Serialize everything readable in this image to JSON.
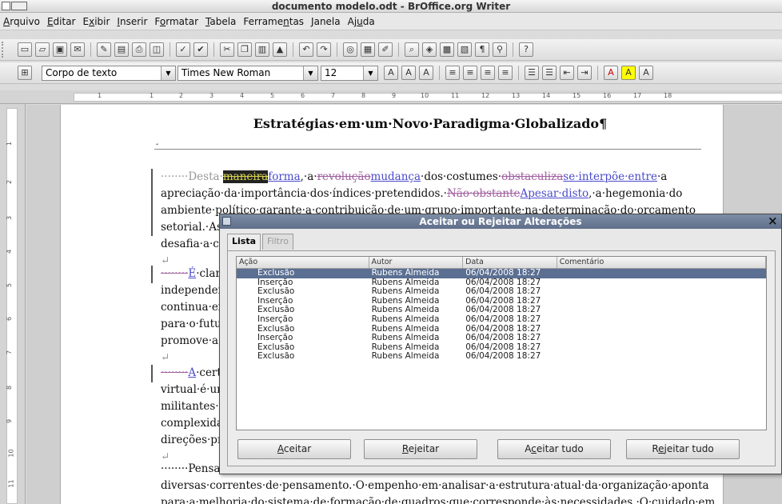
{
  "window": {
    "title": "documento modelo.odt - BrOffice.org Writer"
  },
  "menu": [
    {
      "pre": "",
      "key": "A",
      "post": "rquivo"
    },
    {
      "pre": "",
      "key": "E",
      "post": "ditar"
    },
    {
      "pre": "E",
      "key": "x",
      "post": "ibir"
    },
    {
      "pre": "",
      "key": "I",
      "post": "nserir"
    },
    {
      "pre": "F",
      "key": "o",
      "post": "rmatar"
    },
    {
      "pre": "",
      "key": "T",
      "post": "abela"
    },
    {
      "pre": "Ferrame",
      "key": "n",
      "post": "tas"
    },
    {
      "pre": "",
      "key": "J",
      "post": "anela"
    },
    {
      "pre": "Aj",
      "key": "u",
      "post": "da"
    }
  ],
  "format_bar": {
    "paragraph_style": "Corpo de texto",
    "font_name": "Times New Roman",
    "font_size": "12"
  },
  "ruler": {
    "h_ticks": [
      "1",
      "1",
      "2",
      "3",
      "4",
      "5",
      "6",
      "7",
      "8",
      "9",
      "10",
      "11",
      "12",
      "13",
      "14",
      "15",
      "16",
      "17",
      "18"
    ],
    "v_ticks": [
      "1",
      "2",
      "3",
      "4",
      "5",
      "6",
      "7",
      "8",
      "9",
      "10",
      "11"
    ]
  },
  "document": {
    "heading": "Estratégias·em·um·Novo·Paradigma·Globalizado¶",
    "p1": {
      "l1_a": "········Desta·",
      "l1_hl": "maneira",
      "l1_ins1": "forma",
      "l1_b": ",·a·",
      "l1_del1": "revolução",
      "l1_ins2": "mudança",
      "l1_c": "·dos·costumes·",
      "l1_del2": "obstaculiza",
      "l1_ins3": "se·interpõe·entre",
      "l1_d": "·a",
      "l2_a": "apreciação·da·importância·dos·índices·pretendidos.·",
      "l2_del": "Não·obstante",
      "l2_ins": "Apesar·disto",
      "l2_b": ",·a·hegemonia·do",
      "l3": "ambiente·político·garante·a·contribuição·de·um·grupo·importante·na·determinação·do·orçamento",
      "l4": "setorial.·As·expe",
      "l5": "desafia·a·capacid"
    },
    "p2": {
      "l1_del": "········",
      "l1_ins": "É",
      "l1_a": "·claro·qu",
      "l2": "independenteme",
      "l3": "continua·expansã",
      "l4": "para·o·futuro.·A·",
      "l5": "promove·a·alava"
    },
    "p3": {
      "l1_del": "········",
      "l1_ins": "A",
      "l1_a": "·certifica",
      "l2": "virtual·é·uma·da",
      "l3": "militantes·nos·ob",
      "l4": "complexidade·do",
      "l5": "direções·preferen"
    },
    "p4": {
      "l1": "········Pensando",
      "l2": "diversas·correntes·de·pensamento.·O·empenho·em·analisar·a·estrutura·atual·da·organização·aponta",
      "l3": "para·a·melhoria·do·sistema·de·formação·de·quadros·que·corresponde·às·necessidades.·O·cuidado·em"
    },
    "return_mark": "↵",
    "pilcrow_small": "¸"
  },
  "dialog": {
    "title": "Aceitar ou Rejeitar Alterações",
    "close_glyph": "×",
    "tabs": [
      "Lista",
      "Filtro"
    ],
    "columns": [
      "Ação",
      "Autor",
      "Data",
      "Comentário"
    ],
    "rows": [
      {
        "action": "Exclusão",
        "author": "Rubens Almeida",
        "date": "06/04/2008 18:27",
        "comment": "",
        "selected": true
      },
      {
        "action": "Inserção",
        "author": "Rubens Almeida",
        "date": "06/04/2008 18:27",
        "comment": ""
      },
      {
        "action": "Exclusão",
        "author": "Rubens Almeida",
        "date": "06/04/2008 18:27",
        "comment": ""
      },
      {
        "action": "Inserção",
        "author": "Rubens Almeida",
        "date": "06/04/2008 18:27",
        "comment": ""
      },
      {
        "action": "Exclusão",
        "author": "Rubens Almeida",
        "date": "06/04/2008 18:27",
        "comment": ""
      },
      {
        "action": "Inserção",
        "author": "Rubens Almeida",
        "date": "06/04/2008 18:27",
        "comment": ""
      },
      {
        "action": "Exclusão",
        "author": "Rubens Almeida",
        "date": "06/04/2008 18:27",
        "comment": ""
      },
      {
        "action": "Inserção",
        "author": "Rubens Almeida",
        "date": "06/04/2008 18:27",
        "comment": ""
      },
      {
        "action": "Exclusão",
        "author": "Rubens Almeida",
        "date": "06/04/2008 18:27",
        "comment": ""
      },
      {
        "action": "Exclusão",
        "author": "Rubens Almeida",
        "date": "06/04/2008 18:27",
        "comment": ""
      }
    ],
    "buttons": {
      "accept": {
        "pre": "",
        "key": "A",
        "post": "ceitar"
      },
      "reject": {
        "pre": "",
        "key": "R",
        "post": "ejeitar"
      },
      "accept_all": {
        "pre": "A",
        "key": "c",
        "post": "eitar tudo"
      },
      "reject_all": {
        "pre": "R",
        "key": "e",
        "post": "jeitar tudo"
      }
    }
  },
  "colors": {
    "selection": "#5b6f92",
    "deleted_text": "#a060a0",
    "inserted_text": "#4a4acc",
    "dialog_title": "#6b7b96"
  },
  "icons": [
    "new-doc-icon",
    "open-icon",
    "save-icon",
    "mail-icon",
    "export-pdf-icon",
    "print-icon",
    "print-preview-icon",
    "spellcheck-icon",
    "autospell-icon",
    "cut-icon",
    "copy-icon",
    "paste-icon",
    "format-paintbrush-icon",
    "undo-icon",
    "redo-icon",
    "hyperlink-icon",
    "table-icon",
    "draw-icon",
    "navigator-icon",
    "gallery-icon",
    "datasource-icon",
    "nonprinting-chars-icon",
    "zoom-icon",
    "help-icon"
  ]
}
